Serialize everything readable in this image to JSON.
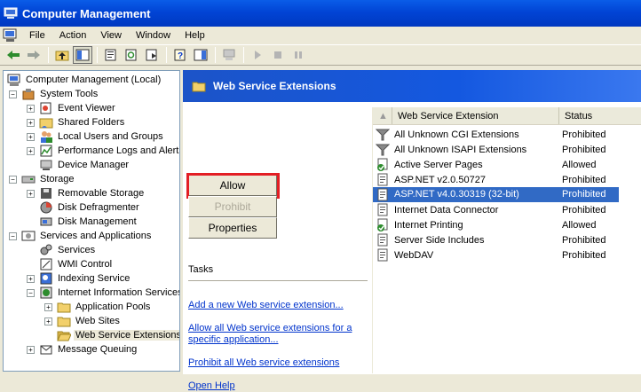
{
  "window": {
    "title": "Computer Management"
  },
  "menu": [
    "File",
    "Action",
    "View",
    "Window",
    "Help"
  ],
  "tree": {
    "root": "Computer Management (Local)",
    "system_tools": "System Tools",
    "event_viewer": "Event Viewer",
    "shared_folders": "Shared Folders",
    "local_users": "Local Users and Groups",
    "perf_logs": "Performance Logs and Alerts",
    "device_manager": "Device Manager",
    "storage": "Storage",
    "removable_storage": "Removable Storage",
    "disk_defrag": "Disk Defragmenter",
    "disk_mgmt": "Disk Management",
    "services_apps": "Services and Applications",
    "services": "Services",
    "wmi": "WMI Control",
    "indexing": "Indexing Service",
    "iis": "Internet Information Services",
    "app_pools": "Application Pools",
    "web_sites": "Web Sites",
    "wse": "Web Service Extensions",
    "msmq": "Message Queuing"
  },
  "panel": {
    "title": "Web Service Extensions",
    "allow": "Allow",
    "prohibit": "Prohibit",
    "properties": "Properties",
    "tasks": "Tasks",
    "link1": "Add a new Web service extension...",
    "link2": "Allow all Web service extensions for a specific application...",
    "link3": "Prohibit all Web service extensions",
    "link4": "Open Help"
  },
  "list": {
    "col1": "Web Service Extension",
    "col2": "Status",
    "rows": [
      {
        "name": "All Unknown CGI Extensions",
        "status": "Prohibited",
        "icon": "filter-icon"
      },
      {
        "name": "All Unknown ISAPI Extensions",
        "status": "Prohibited",
        "icon": "filter-icon"
      },
      {
        "name": "Active Server Pages",
        "status": "Allowed",
        "icon": "allowed-page-icon"
      },
      {
        "name": "ASP.NET v2.0.50727",
        "status": "Prohibited",
        "icon": "prohibited-page-icon"
      },
      {
        "name": "ASP.NET v4.0.30319 (32-bit)",
        "status": "Prohibited",
        "icon": "prohibited-page-icon"
      },
      {
        "name": "Internet Data Connector",
        "status": "Prohibited",
        "icon": "prohibited-page-icon"
      },
      {
        "name": "Internet Printing",
        "status": "Allowed",
        "icon": "allowed-page-icon"
      },
      {
        "name": "Server Side Includes",
        "status": "Prohibited",
        "icon": "prohibited-page-icon"
      },
      {
        "name": "WebDAV",
        "status": "Prohibited",
        "icon": "prohibited-page-icon"
      }
    ]
  },
  "colors": {
    "title_blue": "#0144d5",
    "selection": "#316ac5",
    "link": "#0033cc",
    "highlight_box": "#e31e24"
  }
}
